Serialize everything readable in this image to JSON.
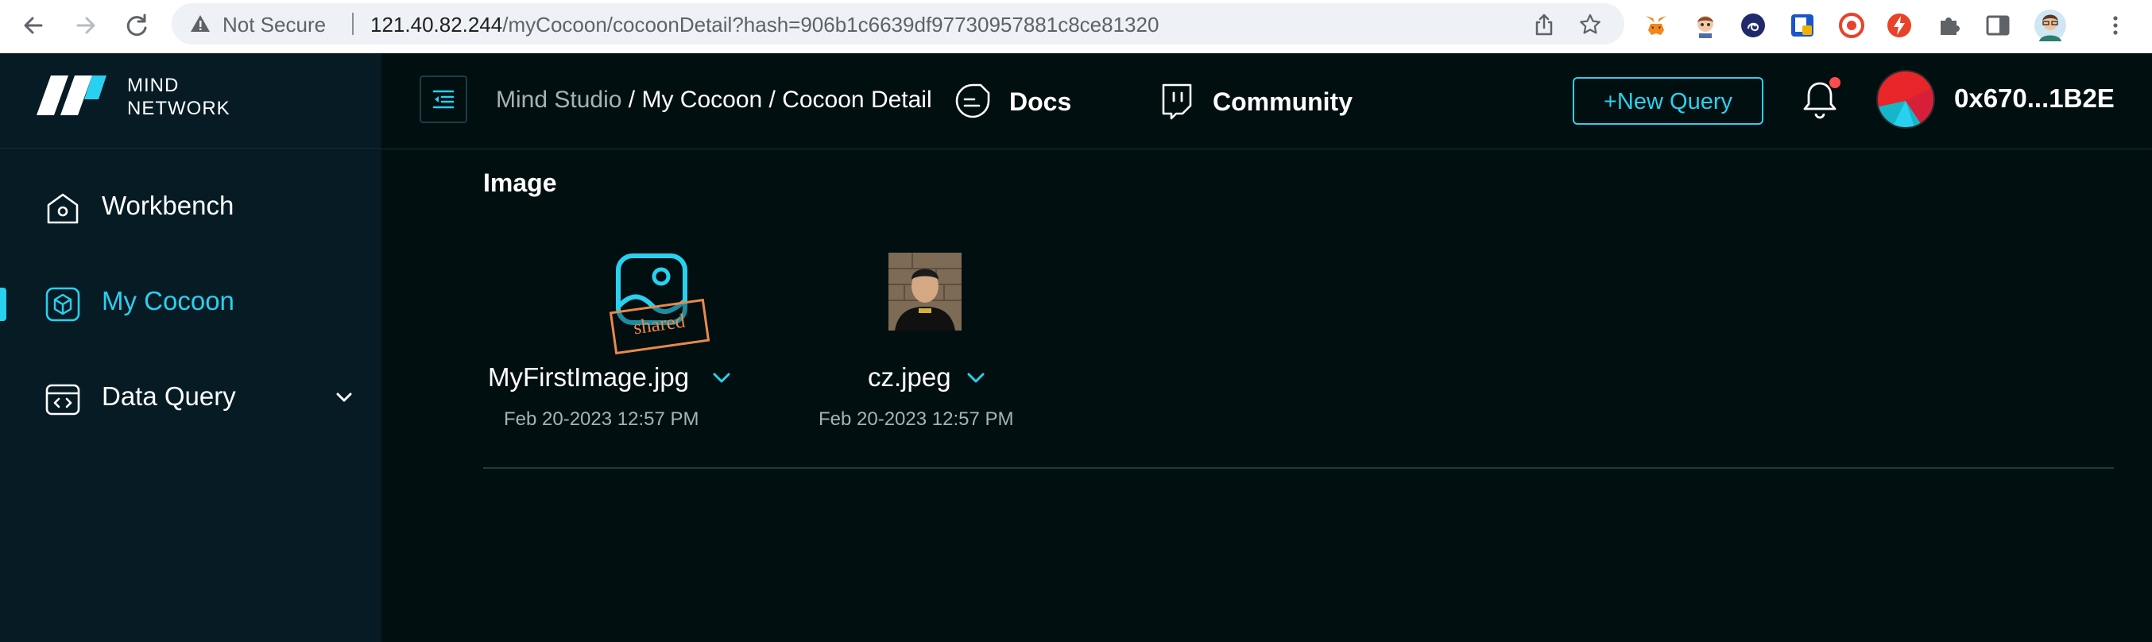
{
  "browser": {
    "security_label": "Not Secure",
    "url_host": "121.40.82.244",
    "url_path": "/myCocoon/cocoonDetail?hash=906b1c6639df97730957881c8ce81320"
  },
  "brand": {
    "line1": "MIND",
    "line2": "NETWORK",
    "accent": "#2ad0ef"
  },
  "sidebar": {
    "items": [
      {
        "label": "Workbench",
        "icon": "home-icon",
        "active": false
      },
      {
        "label": "My Cocoon",
        "icon": "cube-icon",
        "active": true
      },
      {
        "label": "Data Query",
        "icon": "code-icon",
        "active": false
      }
    ]
  },
  "header": {
    "breadcrumb": {
      "root": "Mind Studio",
      "sep1": " / ",
      "mid": "My Cocoon",
      "sep2": " / ",
      "current": "Cocoon Detail"
    },
    "docs_label": "Docs",
    "community_label": "Community",
    "new_query_label": "+New Query",
    "wallet": "0x670...1B2E"
  },
  "main": {
    "section_title": "Image",
    "files": [
      {
        "name": "MyFirstImage.jpg",
        "date": "Feb 20-2023 12:57 PM",
        "stamp": "shared",
        "thumb": "image-icon"
      },
      {
        "name": "cz.jpeg",
        "date": "Feb 20-2023 12:57 PM",
        "thumb": "photo-thumbnail"
      }
    ]
  }
}
